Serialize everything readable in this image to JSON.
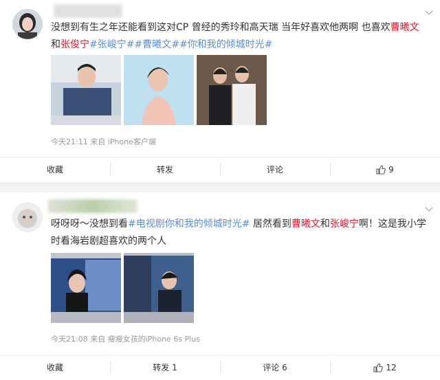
{
  "post1": {
    "text_parts": [
      {
        "t": "没想到有生之年还能看到这对CP 曾经的秀玲和高天瑞 当年好喜欢他两啊 也喜欢",
        "c": ""
      },
      {
        "t": "曹曦文",
        "c": "hl"
      },
      {
        "t": "和",
        "c": ""
      },
      {
        "t": "张",
        "c": "hl"
      },
      {
        "t": "俊宁",
        "c": "hl"
      },
      {
        "t": "#张峻宁#",
        "c": "tag"
      },
      {
        "t": "#曹曦文#",
        "c": "tag"
      },
      {
        "t": "#你和我的倾城时光#",
        "c": "tag"
      }
    ],
    "meta": "今天21:11 来自 iPhone客户端",
    "actions": {
      "collect": "收藏",
      "repost": "转发",
      "comment": "评论",
      "like": "9"
    }
  },
  "post2": {
    "text_parts": [
      {
        "t": "呀呀呀～没想到看",
        "c": ""
      },
      {
        "t": "#电视剧你和我的倾城时光#",
        "c": "tag"
      },
      {
        "t": " 居然看到",
        "c": ""
      },
      {
        "t": "曹曦文",
        "c": "hl"
      },
      {
        "t": "和",
        "c": ""
      },
      {
        "t": "张峻宁",
        "c": "hl"
      },
      {
        "t": "啊！这是我小学时看海岩剧超喜欢的两个人",
        "c": ""
      }
    ],
    "meta": "今天21:08 来自 瘦瘦女孩的iPhone 6s Plus",
    "actions": {
      "collect": "收藏",
      "repost": "转发 1",
      "comment": "评论 6",
      "like": "12"
    }
  },
  "colors": {
    "highlight": "#e6162d",
    "hashtag": "#5b8ed7",
    "meta": "#999999"
  }
}
